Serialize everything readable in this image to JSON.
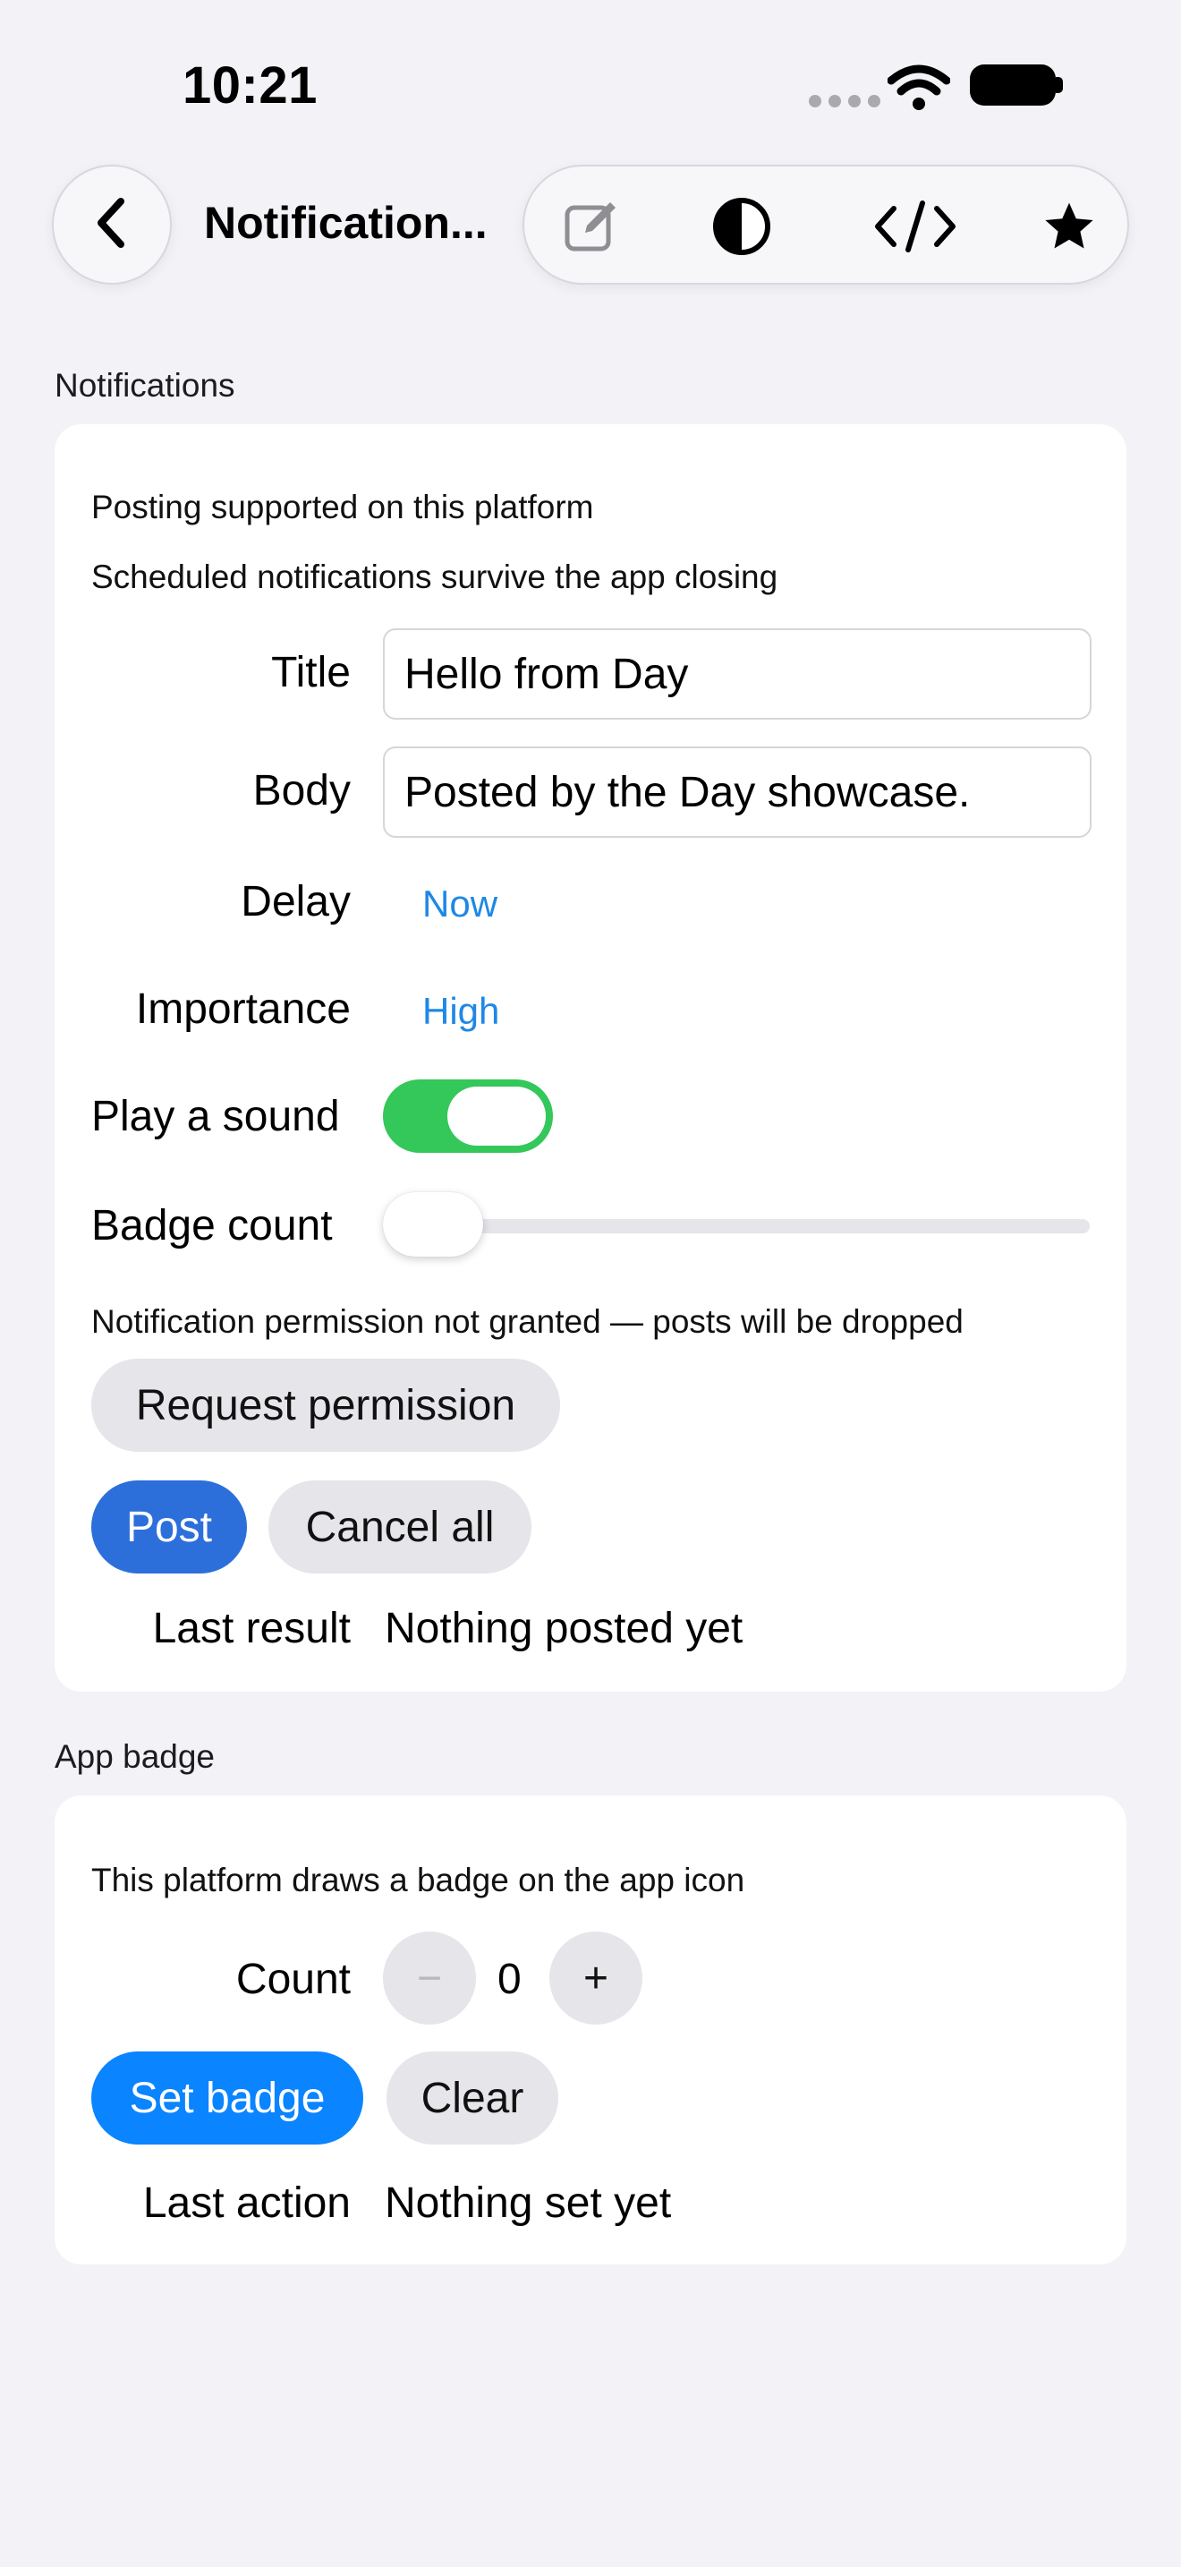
{
  "status_bar": {
    "time": "10:21"
  },
  "nav": {
    "title": "Notification...",
    "toolbar_icons": [
      "edit-icon",
      "contrast-icon",
      "code-icon",
      "star-icon"
    ]
  },
  "notifications": {
    "header": "Notifications",
    "info_supported": "Posting supported on this platform",
    "info_scheduled": "Scheduled notifications survive the app closing",
    "title_label": "Title",
    "title_value": "Hello from Day",
    "body_label": "Body",
    "body_value": "Posted by the Day showcase.",
    "delay_label": "Delay",
    "delay_value": "Now",
    "importance_label": "Importance",
    "importance_value": "High",
    "sound_label": "Play a sound",
    "sound_on": true,
    "badge_label": "Badge count",
    "badge_value": 0,
    "permission_note": "Notification permission not granted — posts will be dropped",
    "request_button": "Request permission",
    "post_button": "Post",
    "cancel_button": "Cancel all",
    "last_result_label": "Last result",
    "last_result_value": "Nothing posted yet"
  },
  "app_badge": {
    "header": "App badge",
    "info": "This platform draws a badge on the app icon",
    "count_label": "Count",
    "minus": "−",
    "count_value": "0",
    "plus": "+",
    "set_button": "Set badge",
    "clear_button": "Clear",
    "last_action_label": "Last action",
    "last_action_value": "Nothing set yet"
  },
  "colors": {
    "toggle_on": "#34c759",
    "post_button": "#2c6fdb",
    "set_badge_button": "#0a84ff",
    "link": "#1e88e5",
    "background": "#f2f2f7"
  }
}
